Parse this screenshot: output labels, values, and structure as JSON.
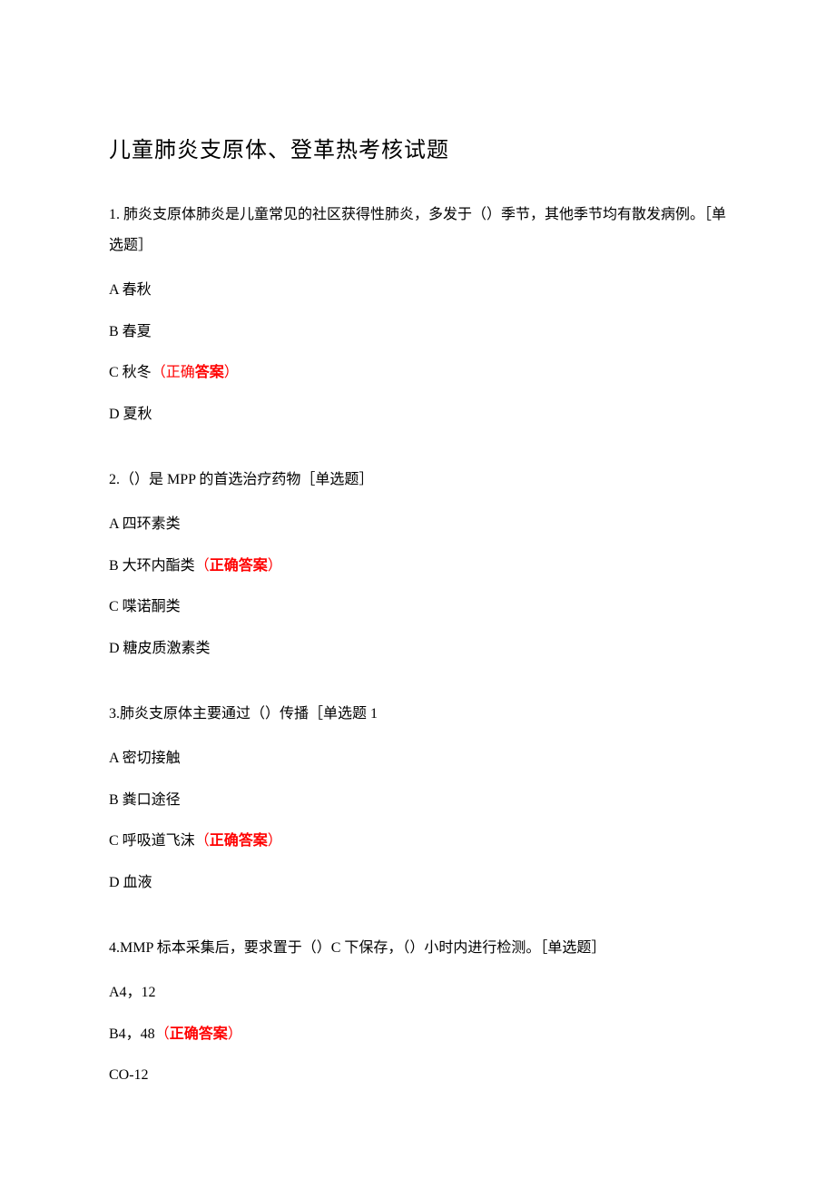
{
  "title": "儿童肺炎支原体、登革热考核试题",
  "correctLabel": "（正确",
  "correctBold": "答案",
  "correctTail": "）",
  "correctLabel2": "（",
  "correctBold2": "正确答案",
  "correctTail2": "）",
  "questions": [
    {
      "text": "1. 肺炎支原体肺炎是儿童常见的社区获得性肺炎，多发于（）季节，其他季节均有散发病例。［单选题］",
      "options": [
        {
          "label": "A 春秋",
          "correct": false,
          "style": 0
        },
        {
          "label": "B 春夏",
          "correct": false,
          "style": 0
        },
        {
          "label": "C 秋冬",
          "correct": true,
          "style": 1
        },
        {
          "label": "D 夏秋",
          "correct": false,
          "style": 0
        }
      ]
    },
    {
      "text": "2.（）是 MPP 的首选治疗药物［单选题］",
      "options": [
        {
          "label": "A 四环素类",
          "correct": false,
          "style": 0
        },
        {
          "label": "B 大环内酯类",
          "correct": true,
          "style": 2
        },
        {
          "label": "C 喋诺酮类",
          "correct": false,
          "style": 0
        },
        {
          "label": "D 糖皮质激素类",
          "correct": false,
          "style": 0
        }
      ]
    },
    {
      "text": "3.肺炎支原体主要通过（）传播［单选题 1",
      "options": [
        {
          "label": "A 密切接触",
          "correct": false,
          "style": 0
        },
        {
          "label": "B 粪口途径",
          "correct": false,
          "style": 0
        },
        {
          "label": "C 呼吸道飞沫",
          "correct": true,
          "style": 2
        },
        {
          "label": "D 血液",
          "correct": false,
          "style": 0
        }
      ]
    },
    {
      "text": "4.MMP 标本采集后，要求置于（）C 下保存，（）小时内进行检测。［单选题］",
      "options": [
        {
          "label": "A4，12",
          "correct": false,
          "style": 0
        },
        {
          "label": "B4，48",
          "correct": true,
          "style": 2
        },
        {
          "label": "CO-12",
          "correct": false,
          "style": 0
        }
      ]
    }
  ]
}
